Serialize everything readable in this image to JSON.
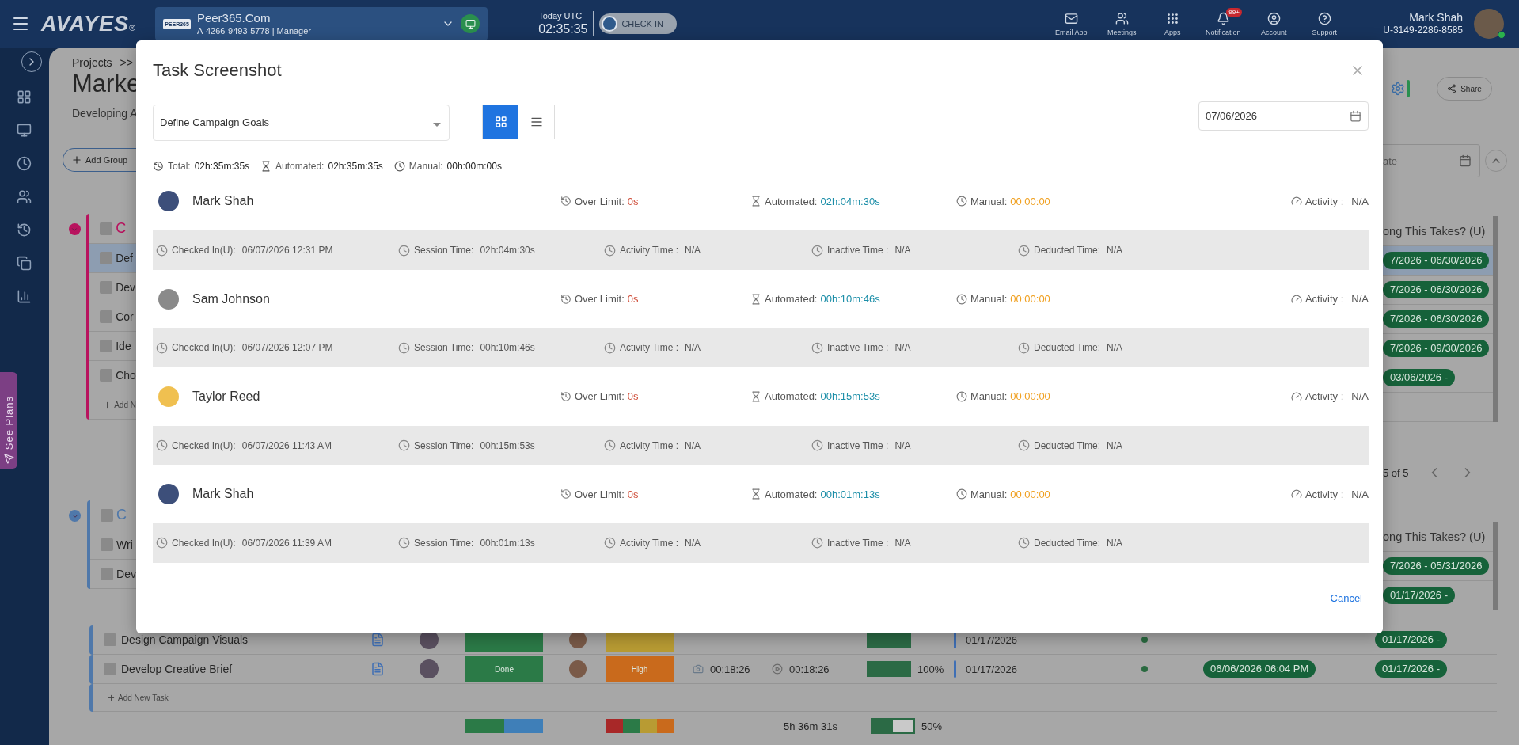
{
  "header": {
    "logo": "AVAYES",
    "logo_mark": "®",
    "company": {
      "logo": "PEER365",
      "name": "Peer365.Com",
      "account": "A-4266-9493-5778 | Manager"
    },
    "clock": {
      "label": "Today UTC",
      "time": "02:35:35"
    },
    "check_in": {
      "label": "CHECK IN",
      "on": false
    },
    "apps": [
      {
        "kind": "mail",
        "label": "Email App"
      },
      {
        "kind": "meetings",
        "label": "Meetings"
      },
      {
        "kind": "apps",
        "label": "Apps"
      },
      {
        "kind": "notification",
        "label": "Notification",
        "badge": "99+"
      },
      {
        "kind": "account",
        "label": "Account"
      },
      {
        "kind": "support",
        "label": "Support"
      }
    ],
    "user": {
      "name": "Mark Shah",
      "id": "U-3149-2286-8585",
      "online": true
    }
  },
  "sidebar": {
    "see_plans": "See Plans"
  },
  "page": {
    "breadcrumb": "Projects",
    "breadcrumb_separator": ">>",
    "title": "Marke",
    "subtitle": "Developing A",
    "add_group": "Add Group",
    "share": "Share",
    "date_placeholder": "ate",
    "pagination": "5 of 5"
  },
  "groups": [
    {
      "color": "#b8135e",
      "title": "C",
      "checked": false,
      "column_header": "ong This Takes? (U)",
      "add_task": "Add N",
      "tasks": [
        {
          "kind": "stub",
          "name": "Def",
          "selected": true,
          "timeline": "7/2026 - 06/30/2026"
        },
        {
          "kind": "stub",
          "name": "Dev",
          "selected": false,
          "timeline": "7/2026 - 06/30/2026"
        },
        {
          "kind": "stub",
          "name": "Cor",
          "selected": false,
          "timeline": "7/2026 - 06/30/2026"
        },
        {
          "kind": "stub",
          "name": "Ide",
          "selected": false,
          "timeline": "7/2026 - 09/30/2026"
        },
        {
          "kind": "stub",
          "name": "Cho",
          "selected": false,
          "timeline": "03/06/2026 -"
        }
      ]
    },
    {
      "color": "#4f78aa",
      "title": "C",
      "checked": false,
      "column_header": "ong This Takes? (U)",
      "add_task": "Add New Task",
      "tasks": [
        {
          "kind": "stub",
          "name": "Wri",
          "selected": false,
          "timeline": "7/2026 - 05/31/2026"
        },
        {
          "kind": "stub",
          "name": "Dev",
          "selected": false,
          "timeline": "01/17/2026 -"
        },
        {
          "kind": "full",
          "name": "Design Campaign Visuals",
          "selected": false,
          "status": {
            "color": "#2b7a47"
          },
          "priority": {
            "color": "#b89b33"
          },
          "level": 1,
          "start_date": "01/17/2026",
          "timeline": "01/17/2026 -"
        },
        {
          "kind": "full",
          "name": "Develop Creative Brief",
          "selected": false,
          "status": {
            "label": "Done",
            "color": "#2b7a47"
          },
          "priority": {
            "label": "High",
            "color": "#c96a1c"
          },
          "screenshot_time": "00:18:26",
          "tracked_time": "00:18:26",
          "level": 1,
          "progress": "100%",
          "start_date": "01/17/2026",
          "due": "06/06/2026 06:04 PM",
          "timeline": "01/17/2026 -"
        }
      ],
      "summary": {
        "status_segments": [
          {
            "color": "#2b7a47"
          },
          {
            "color": "#3f7fb8"
          }
        ],
        "priority_segments": [
          {
            "color": "#a82828"
          },
          {
            "color": "#2b7a47"
          },
          {
            "color": "#b89b33"
          },
          {
            "color": "#c96a1c"
          }
        ],
        "total_time": "5h 36m 31s",
        "level": 0.5,
        "progress": "50%"
      }
    }
  ],
  "modal": {
    "title": "Task Screenshot",
    "task": "Define Campaign Goals",
    "views": [
      {
        "kind": "grid",
        "selected": true
      },
      {
        "kind": "list",
        "selected": false
      }
    ],
    "date": "07/06/2026",
    "totals": [
      {
        "kind": "total",
        "label": "Total:",
        "value": "02h:35m:35s"
      },
      {
        "kind": "automated",
        "label": "Automated:",
        "value": "02h:35m:35s"
      },
      {
        "kind": "manual",
        "label": "Manual:",
        "value": "00h:00m:00s"
      }
    ],
    "sessions": [
      {
        "name": "Mark Shah",
        "stats": [
          {
            "kind": "over_limit",
            "label": "Over Limit:",
            "value": "0s"
          },
          {
            "kind": "automated",
            "label": "Automated:",
            "value": "02h:04m:30s"
          },
          {
            "kind": "manual",
            "label": "Manual:",
            "value": "00:00:00"
          },
          {
            "kind": "activity",
            "label": "Activity :",
            "value": "N/A"
          }
        ],
        "details": [
          {
            "label": "Checked In(U):",
            "value": "06/07/2026 12:31 PM"
          },
          {
            "label": "Session Time:",
            "value": "02h:04m:30s"
          },
          {
            "label": "Activity Time :",
            "value": "N/A"
          },
          {
            "label": "Inactive Time :",
            "value": "N/A"
          },
          {
            "label": "Deducted Time:",
            "value": "N/A"
          }
        ]
      },
      {
        "name": "Sam Johnson",
        "stats": [
          {
            "kind": "over_limit",
            "label": "Over Limit:",
            "value": "0s"
          },
          {
            "kind": "automated",
            "label": "Automated:",
            "value": "00h:10m:46s"
          },
          {
            "kind": "manual",
            "label": "Manual:",
            "value": "00:00:00"
          },
          {
            "kind": "activity",
            "label": "Activity :",
            "value": "N/A"
          }
        ],
        "details": [
          {
            "label": "Checked In(U):",
            "value": "06/07/2026 12:07 PM"
          },
          {
            "label": "Session Time:",
            "value": "00h:10m:46s"
          },
          {
            "label": "Activity Time :",
            "value": "N/A"
          },
          {
            "label": "Inactive Time :",
            "value": "N/A"
          },
          {
            "label": "Deducted Time:",
            "value": "N/A"
          }
        ]
      },
      {
        "name": "Taylor Reed",
        "stats": [
          {
            "kind": "over_limit",
            "label": "Over Limit:",
            "value": "0s"
          },
          {
            "kind": "automated",
            "label": "Automated:",
            "value": "00h:15m:53s"
          },
          {
            "kind": "manual",
            "label": "Manual:",
            "value": "00:00:00"
          },
          {
            "kind": "activity",
            "label": "Activity :",
            "value": "N/A"
          }
        ],
        "details": [
          {
            "label": "Checked In(U):",
            "value": "06/07/2026 11:43 AM"
          },
          {
            "label": "Session Time:",
            "value": "00h:15m:53s"
          },
          {
            "label": "Activity Time :",
            "value": "N/A"
          },
          {
            "label": "Inactive Time :",
            "value": "N/A"
          },
          {
            "label": "Deducted Time:",
            "value": "N/A"
          }
        ]
      },
      {
        "name": "Mark Shah",
        "stats": [
          {
            "kind": "over_limit",
            "label": "Over Limit:",
            "value": "0s"
          },
          {
            "kind": "automated",
            "label": "Automated:",
            "value": "00h:01m:13s"
          },
          {
            "kind": "manual",
            "label": "Manual:",
            "value": "00:00:00"
          },
          {
            "kind": "activity",
            "label": "Activity :",
            "value": "N/A"
          }
        ],
        "details": [
          {
            "label": "Checked In(U):",
            "value": "06/07/2026 11:39 AM"
          },
          {
            "label": "Session Time:",
            "value": "00h:01m:13s"
          },
          {
            "label": "Activity Time :",
            "value": "N/A"
          },
          {
            "label": "Inactive Time :",
            "value": "N/A"
          },
          {
            "label": "Deducted Time:",
            "value": "N/A"
          }
        ]
      }
    ],
    "cancel": "Cancel"
  }
}
